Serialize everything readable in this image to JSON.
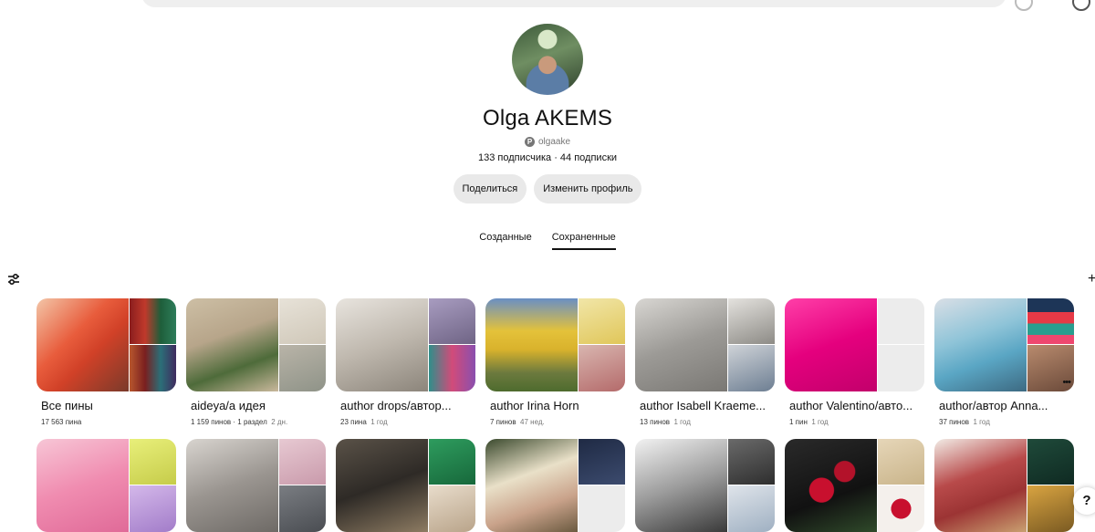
{
  "profile": {
    "name": "Olga AKEMS",
    "handle": "olgaake",
    "stats": "133 подписчика · 44 подписки",
    "share_label": "Поделиться",
    "edit_label": "Изменить профиль"
  },
  "tabs": [
    {
      "label": "Созданные",
      "active": false
    },
    {
      "label": "Сохраненные",
      "active": true
    }
  ],
  "boards_row1": [
    {
      "title": "Все пины",
      "count": "17 563 пина",
      "age": ""
    },
    {
      "title": "aideya/а идея",
      "count": "1 159 пинов · 1 раздел",
      "age": "2 дн."
    },
    {
      "title": "author drops/автор...",
      "count": "23 пина",
      "age": "1 год"
    },
    {
      "title": "author Irina Horn",
      "count": "7 пинов",
      "age": "47 нед."
    },
    {
      "title": "author Isabell Kraeme...",
      "count": "13 пинов",
      "age": "1 год"
    },
    {
      "title": "author Valentino/авто...",
      "count": "1 пин",
      "age": "1 год"
    },
    {
      "title": "author/автор Anna...",
      "count": "37 пинов",
      "age": "1 год"
    }
  ],
  "colors": {
    "button_bg": "#e9e9e9",
    "muted_text": "#767676",
    "accent_red": "#e60023"
  },
  "icons": {
    "filter": "filter-icon",
    "add": "plus-icon",
    "help": "help-icon",
    "more": "more-icon",
    "pinterest": "pinterest-icon"
  },
  "help": {
    "label": "?"
  }
}
